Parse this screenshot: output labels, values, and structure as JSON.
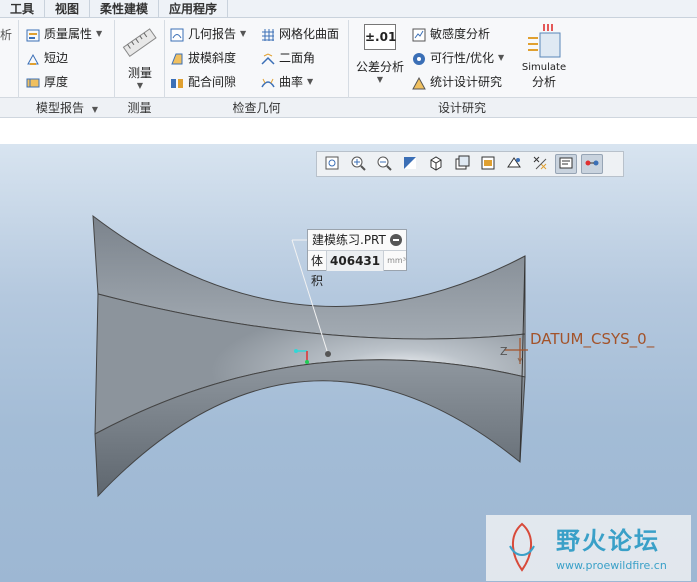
{
  "tabs": [
    "工具",
    "视图",
    "柔性建模",
    "应用程序"
  ],
  "ribbon": {
    "partial_left": "析",
    "model_report": {
      "items": [
        "质量属性",
        "短边",
        "厚度"
      ],
      "group_label": "模型报告"
    },
    "measure": {
      "label": "测量",
      "group_label": "测量"
    },
    "inspect_geometry": {
      "col1": [
        "几何报告",
        "拔模斜度",
        "配合间隙"
      ],
      "col2": [
        "网格化曲面",
        "二面角",
        "曲率"
      ],
      "group_label": "检查几何"
    },
    "tolerance": {
      "value_text": "±.01",
      "label": "公差分析"
    },
    "design_study": {
      "items": [
        "敏感度分析",
        "可行性/优化",
        "统计设计研究"
      ],
      "simulate_top": "Simulate",
      "simulate_bottom": "分析",
      "group_label": "设计研究"
    }
  },
  "viewport": {
    "callout": {
      "title": "建模练习.PRT",
      "prop_label": "体积",
      "prop_value": "406431",
      "unit": "mm³"
    },
    "csys_label": "DATUM_CSYS_0_",
    "axis_label": "Z",
    "colors": {
      "bg_top": "#d8e4f0",
      "bg_bottom": "#9db7d3",
      "model": "#8a939c",
      "csys": "#a3532a"
    }
  },
  "watermark": {
    "title": "野火论坛",
    "url": "www.proewildfire.cn"
  }
}
